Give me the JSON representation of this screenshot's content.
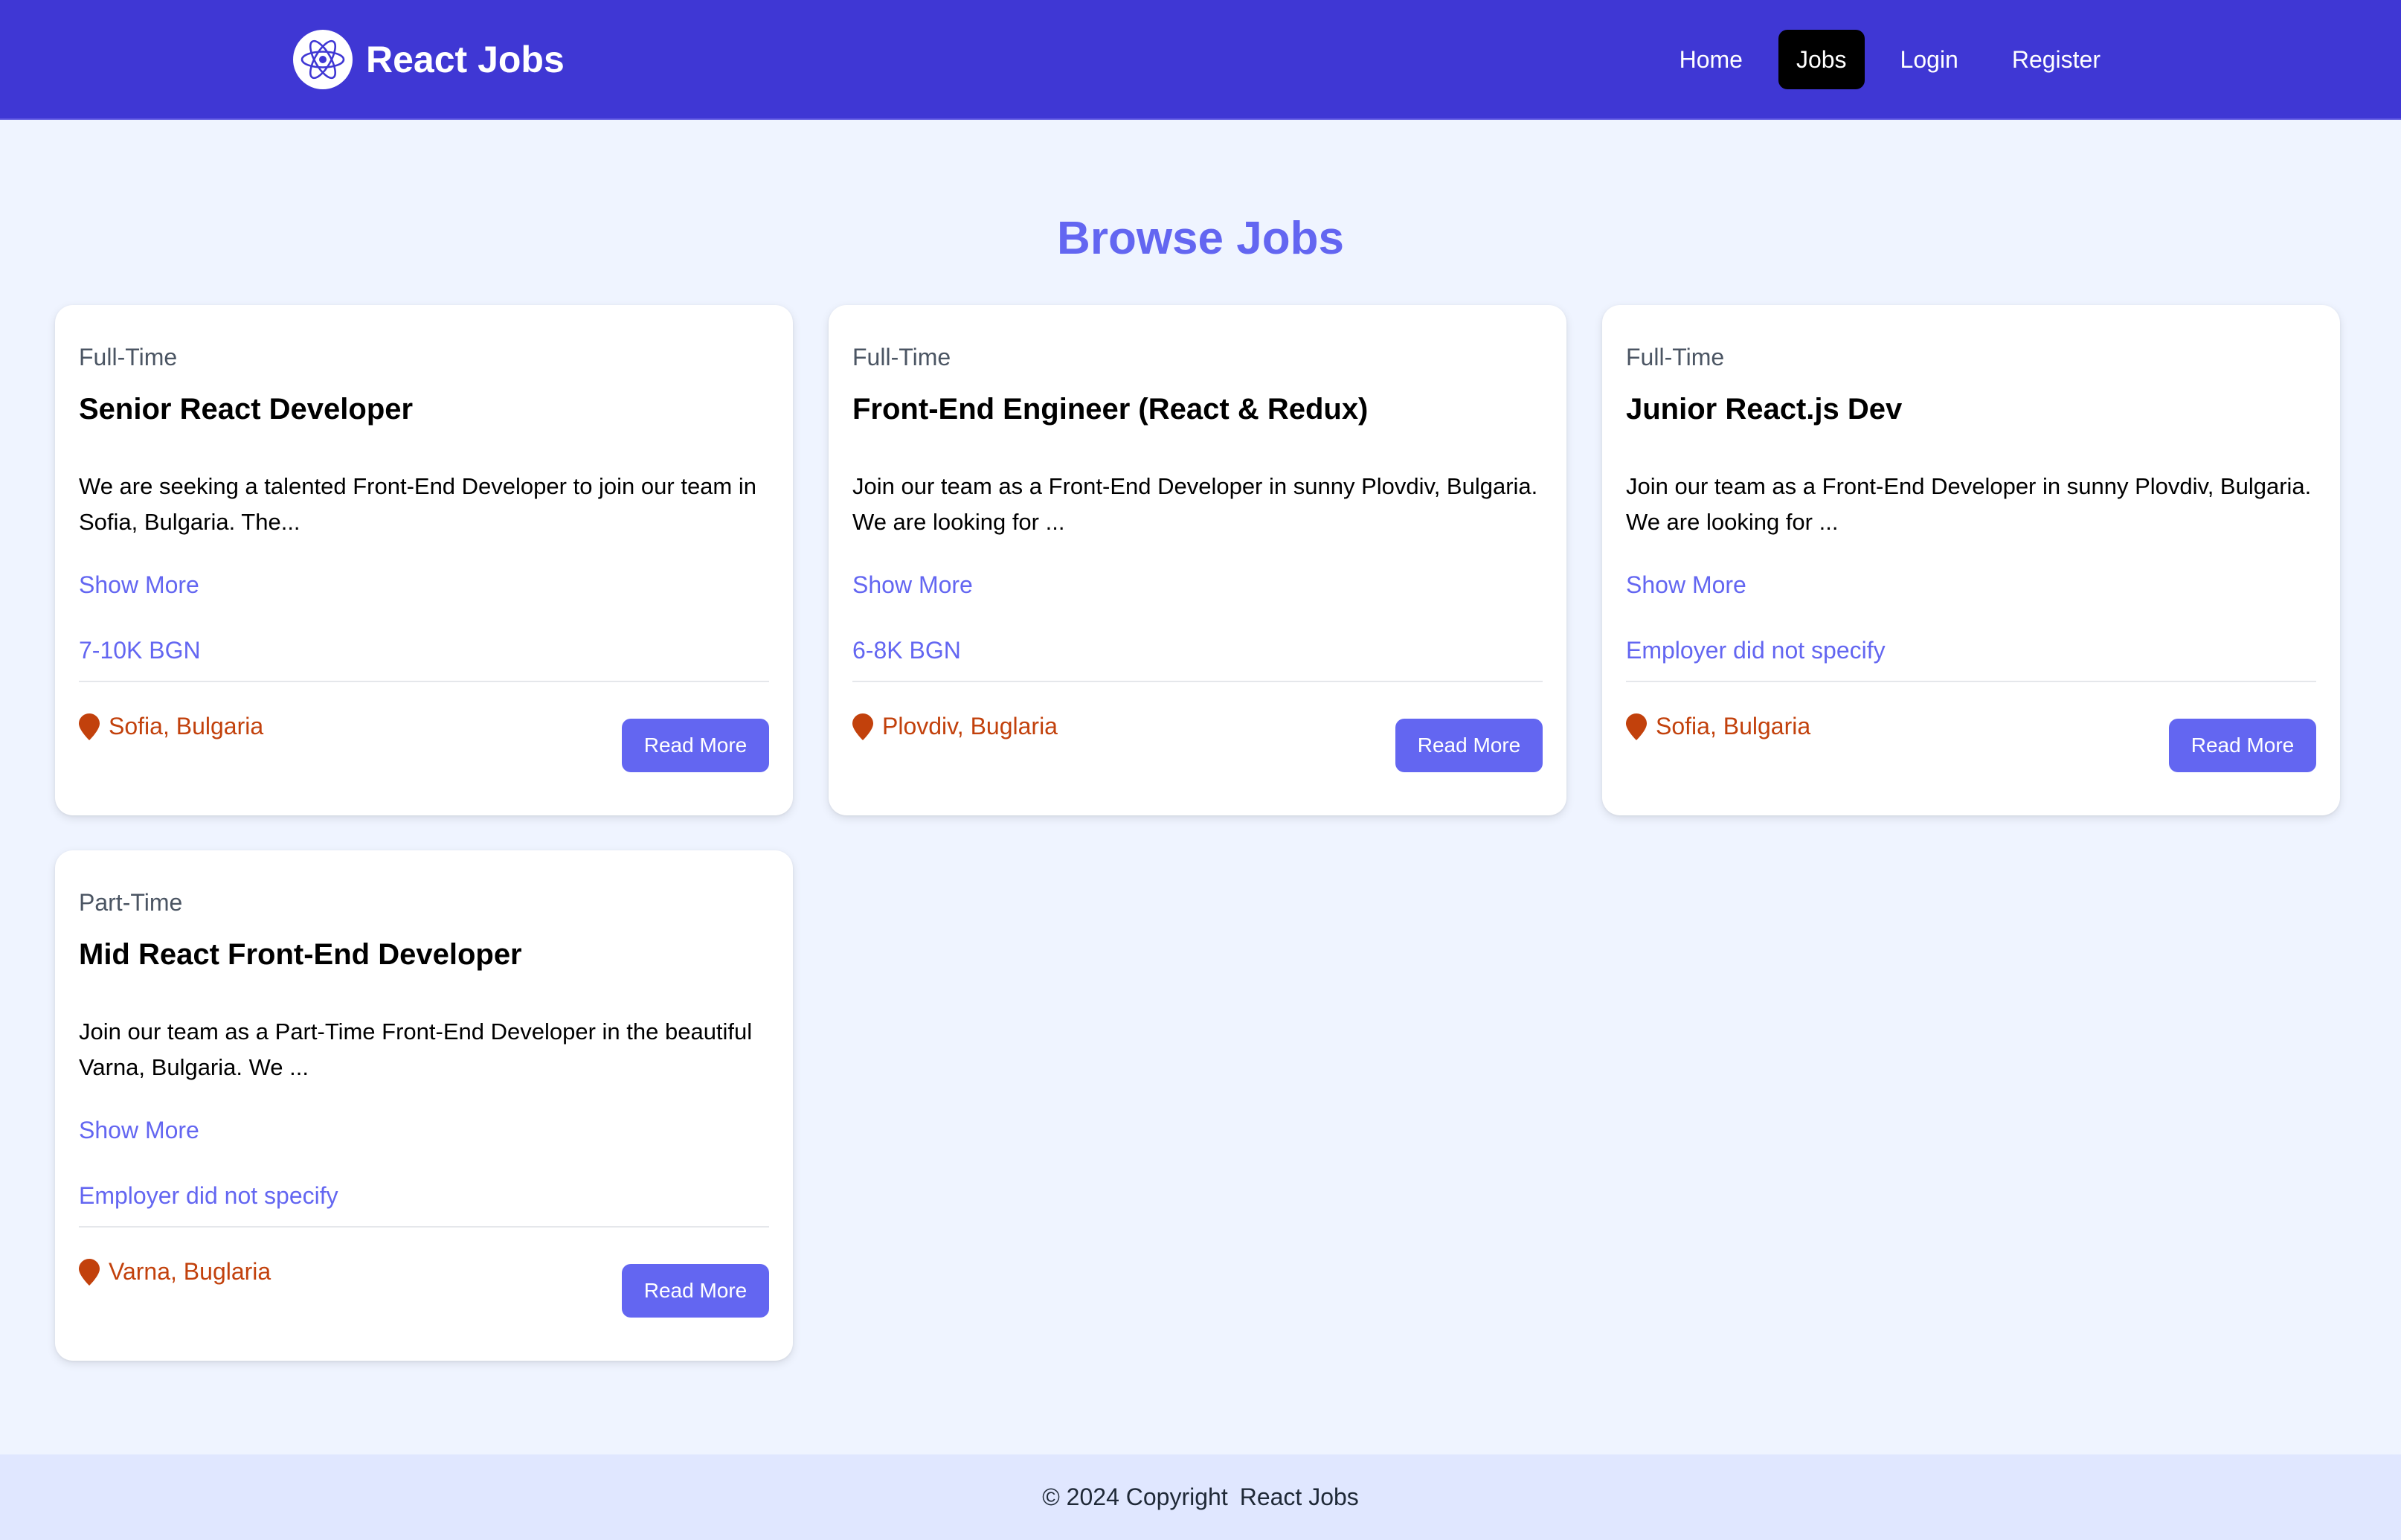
{
  "navbar": {
    "brand": "React Jobs",
    "logo_icon": "react-atom-icon",
    "links": [
      {
        "label": "Home",
        "active": false
      },
      {
        "label": "Jobs",
        "active": true
      },
      {
        "label": "Login",
        "active": false
      },
      {
        "label": "Register",
        "active": false
      }
    ]
  },
  "page": {
    "title": "Browse Jobs"
  },
  "jobs": [
    {
      "type": "Full-Time",
      "title": "Senior React Developer",
      "description": "We are seeking a talented Front-End Developer to join our team in Sofia, Bulgaria. The...",
      "show_more": "Show More",
      "salary": "7-10K BGN",
      "location": "Sofia, Bulgaria",
      "read_more": "Read More"
    },
    {
      "type": "Full-Time",
      "title": "Front-End Engineer (React & Redux)",
      "description": "Join our team as a Front-End Developer in sunny Plovdiv, Bulgaria. We are looking for ...",
      "show_more": "Show More",
      "salary": "6-8K BGN",
      "location": "Plovdiv, Buglaria",
      "read_more": "Read More"
    },
    {
      "type": "Full-Time",
      "title": "Junior React.js Dev",
      "description": "Join our team as a Front-End Developer in sunny Plovdiv, Bulgaria. We are looking for ...",
      "show_more": "Show More",
      "salary": "Employer did not specify",
      "location": "Sofia, Bulgaria",
      "read_more": "Read More"
    },
    {
      "type": "Part-Time",
      "title": "Mid React Front-End Developer",
      "description": "Join our team as a Part-Time Front-End Developer in the beautiful Varna, Bulgaria. We ...",
      "show_more": "Show More",
      "salary": "Employer did not specify",
      "location": "Varna, Buglaria",
      "read_more": "Read More"
    }
  ],
  "footer": {
    "copyright": "© 2024 Copyright",
    "brand": "React Jobs"
  },
  "colors": {
    "navbar_bg": "#3f37d4",
    "accent": "#6366f1",
    "location": "#c2410c",
    "page_bg": "#eff4ff",
    "footer_bg": "#e0e7ff"
  }
}
